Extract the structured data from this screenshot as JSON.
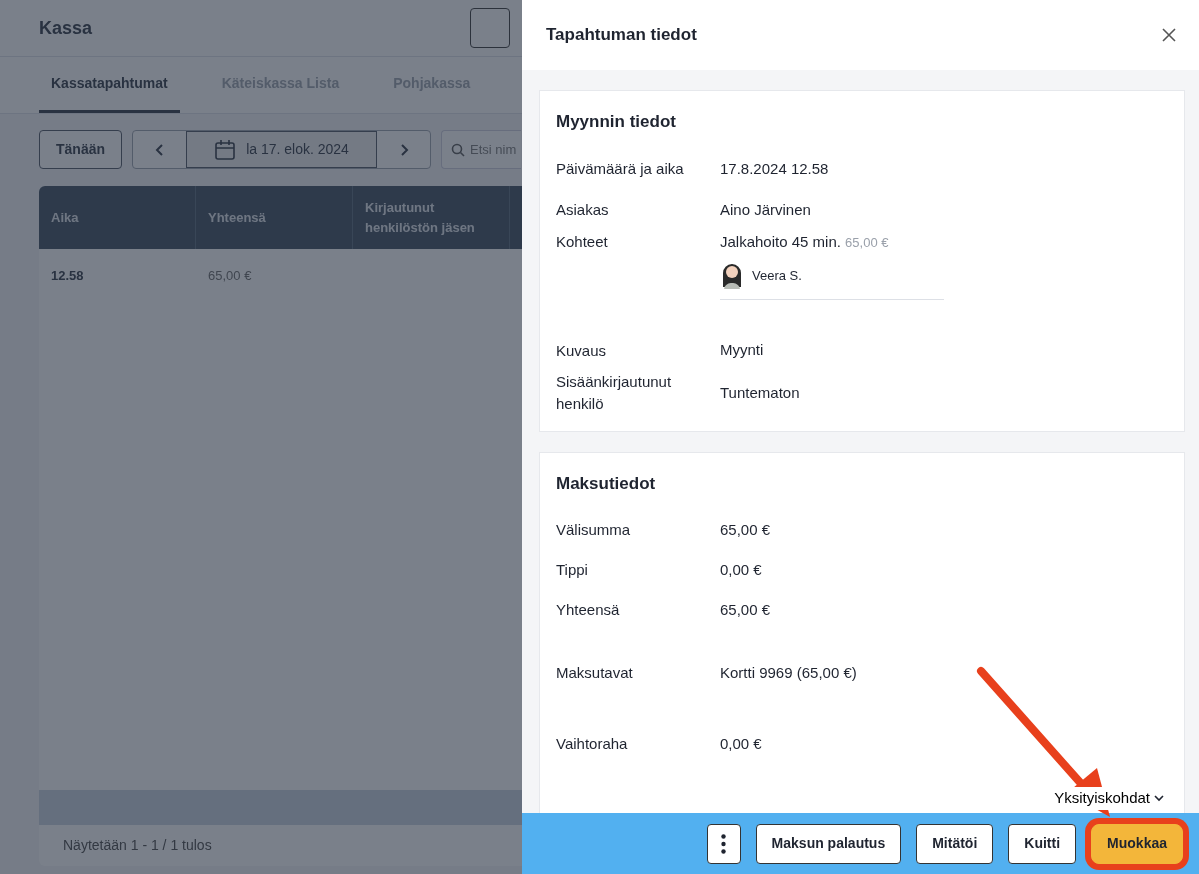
{
  "page": {
    "title": "Kassa",
    "tabs": [
      {
        "label": "Kassatapahtumat",
        "selected": true
      },
      {
        "label": "Käteiskassa Lista",
        "selected": false
      },
      {
        "label": "Pohjakassa",
        "selected": false
      }
    ],
    "today_button": "Tänään",
    "date_label": "la 17. elok. 2024",
    "search": {
      "placeholder": "Etsi nim"
    },
    "table": {
      "columns": [
        "Aika",
        "Yhteensä",
        "Kirjautunut henkilöstön jäsen"
      ],
      "rows": [
        [
          "12.58",
          "65,00 €"
        ]
      ]
    },
    "footer": "Näytetään 1 - 1 / 1 tulos"
  },
  "drawer": {
    "title": "Tapahtuman tiedot",
    "sales_card": {
      "title": "Myynnin tiedot",
      "rows": [
        {
          "kind": "text",
          "label": "Päivämäärä ja aika",
          "value": "17.8.2024 12.58"
        },
        {
          "kind": "text",
          "label": "Asiakas",
          "value": "Aino Järvinen"
        },
        {
          "kind": "items",
          "label": "Kohteet",
          "service": "Jalkahoito 45 min.",
          "price": "65,00 €",
          "staff": "Veera S."
        },
        {
          "kind": "text",
          "label": "Kuvaus",
          "value": "Myynti"
        },
        {
          "kind": "text",
          "label": "Sisäänkirjautunut henkilö",
          "value": "Tuntematon"
        }
      ]
    },
    "payment_card": {
      "title": "Maksutiedot",
      "groups": [
        [
          {
            "label": "Välisumma",
            "value": "65,00 €"
          },
          {
            "label": "Tippi",
            "value": "0,00 €"
          },
          {
            "label": "Yhteensä",
            "value": "65,00 €"
          }
        ],
        [
          {
            "label": "Maksutavat",
            "value": "Kortti 9969 (65,00 €)"
          }
        ],
        [
          {
            "label": "Vaihtoraha",
            "value": "0,00 €"
          }
        ]
      ],
      "details_toggle": "Yksityiskohdat"
    },
    "buttons": [
      {
        "kind": "more"
      },
      {
        "kind": "outline",
        "label": "Maksun palautus"
      },
      {
        "kind": "outline",
        "label": "Mitätöi"
      },
      {
        "kind": "outline",
        "label": "Kuitti"
      },
      {
        "kind": "primary",
        "label": "Muokkaa",
        "highlighted": true
      }
    ]
  },
  "annotations": [
    {
      "kind": "arrow"
    }
  ]
}
